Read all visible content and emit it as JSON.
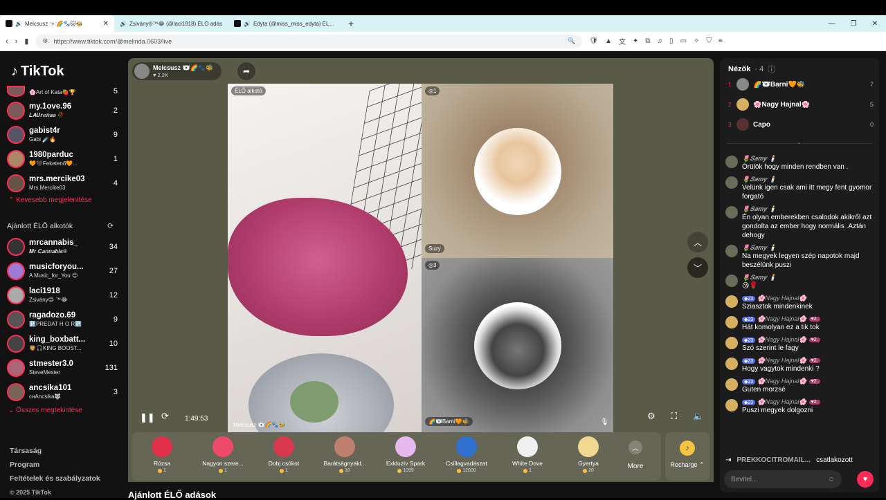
{
  "browser": {
    "tabs": [
      {
        "title": "Melcsusz 🐻‍❄️🌈🐾🐱🐝",
        "active": true
      },
      {
        "title": "Zsivány®™😂 (@laci1918) ÉLŐ adás",
        "active": false
      },
      {
        "title": "Edyta (@miss_miss_edyta) ÉLŐ ad",
        "active": false
      }
    ],
    "new_tab": "+",
    "url": "https://www.tiktok.com/@melinda.0603/live"
  },
  "sidebar": {
    "logo": "TikTok",
    "followed": [
      {
        "name": "",
        "sub": "🌸Art of Kata🍓🏆",
        "count": "5"
      },
      {
        "name": "my.1ove.96",
        "sub": "𝑳𝑨𝑼𝒓𝒆𝒏𝒂𝒂 🥀",
        "count": "2"
      },
      {
        "name": "gabist4r",
        "sub": "Gabi ☄️🔥",
        "count": "9"
      },
      {
        "name": "1980parduc",
        "sub": "🧡🖤Feketenő🧡...",
        "count": "1"
      },
      {
        "name": "mrs.mercike03",
        "sub": "Mrs.Mercike03",
        "count": "4"
      }
    ],
    "show_less": "Kevesebb megjelenítése",
    "suggested_title": "Ajánlott ÉLŐ alkotók",
    "suggested": [
      {
        "name": "mrcannabis_",
        "sub": "𝑴𝒓.𝑪𝒂𝒏𝒏𝒂𝒃𝒊𝒔®",
        "count": "34"
      },
      {
        "name": "musicforyou...",
        "sub": "A Music_for_You 😊",
        "count": "27"
      },
      {
        "name": "laci1918",
        "sub": "Zsivány😊 ™😂",
        "count": "12"
      },
      {
        "name": "ragadozo.69",
        "sub": "🅿️PREDAT H O R🅿️",
        "count": "9"
      },
      {
        "name": "king_boxbatt...",
        "sub": "🦁🎧KING BOOST...",
        "count": "10"
      },
      {
        "name": "stmester3.0",
        "sub": "SteveMester",
        "count": "131"
      },
      {
        "name": "ancsika101",
        "sub": "ᴄʜAncsika🐺",
        "count": "3"
      }
    ],
    "show_all": "Összes megtekintése",
    "footer_links": [
      "Társaság",
      "Program",
      "Feltételek és szabályzatok"
    ],
    "copyright": "© 2025 TikTok"
  },
  "stream": {
    "host_name": "Melcsusz 🐻‍❄️🌈🐾🐝",
    "host_likes": "♥ 2.2K",
    "live_tag": "ÉLŐ alkotó",
    "guest1_badge": "◎1",
    "guest1_name": "Suzy",
    "guest2_badge": "◎3",
    "guest2_name": "🌈🐻‍❄️Barni🧡🐝",
    "main_name": "Melcsusz 🐻‍❄️🌈🐾🐝",
    "timer": "1:49:53"
  },
  "gifts": [
    {
      "name": "Rózsa",
      "price": "1",
      "color": "#e0304a"
    },
    {
      "name": "Nagyon szere...",
      "price": "1",
      "color": "#f04a6a"
    },
    {
      "name": "Dobj csókot",
      "price": "1",
      "color": "#d83850"
    },
    {
      "name": "Barátságnyakl...",
      "price": "10",
      "color": "#c08070"
    },
    {
      "name": "Exkluzív Spark",
      "price": "1099",
      "color": "#e8b8f0"
    },
    {
      "name": "Csillagvadászat",
      "price": "12000",
      "color": "#3070d0"
    },
    {
      "name": "White Dove",
      "price": "1",
      "color": "#f0f0f0"
    },
    {
      "name": "Gyertya",
      "price": "20",
      "color": "#f0d890"
    }
  ],
  "more_label": "More",
  "recharge_label": "Recharge ⌃",
  "bottom_title": "Ajánlott ÉLŐ adások",
  "viewers": {
    "title": "Nézők",
    "count": "· 4",
    "list": [
      {
        "rank": "1",
        "name": "🌈🐻‍❄️Barni🧡🐝",
        "count": "7"
      },
      {
        "rank": "2",
        "name": "🌸Nagy Hajnal🌸",
        "count": "5"
      },
      {
        "rank": "3",
        "name": "Capo",
        "count": "0"
      }
    ]
  },
  "chat": [
    {
      "user": "🌷𝑺𝒂𝒎𝒚 🕯️",
      "text": "Örülök hogy minden rendben van ."
    },
    {
      "user": "🌷𝑺𝒂𝒎𝒚 🕯️",
      "text": "Velünk igen csak ami itt megy fent gyomor forgató"
    },
    {
      "user": "🌷𝑺𝒂𝒎𝒚 🕯️",
      "text": "Én olyan emberekben csalodok akikről azt gondolta az ember hogy normális .Aztán dehogy"
    },
    {
      "user": "🌷𝑺𝒂𝒎𝒚 🕯️",
      "text": "Na megyek legyen szép napotok majd beszélünk puszi"
    },
    {
      "user": "🌷𝑺𝒂𝒎𝒚 🕯️",
      "text": "😘🌹"
    },
    {
      "user": "🌸Nagy Hajnal🌸",
      "lvl": "23",
      "text": "Sziasztok mindenkinek"
    },
    {
      "user": "🌸Nagy Hajnal🌸",
      "lvl": "23",
      "fan": "2.",
      "text": "Hát komolyan ez a tik tok"
    },
    {
      "user": "🌸Nagy Hajnal🌸",
      "lvl": "23",
      "fan": "2.",
      "text": "Szó szerint le fagy"
    },
    {
      "user": "🌸Nagy Hajnal🌸",
      "lvl": "23",
      "fan": "2.",
      "text": "Hogy vagytok mindenki ?"
    },
    {
      "user": "🌸Nagy Hajnal🌸",
      "lvl": "23",
      "fan": "2.",
      "text": "Guten morzsé"
    },
    {
      "user": "🌸Nagy Hajnal🌸",
      "lvl": "23",
      "fan": "2.",
      "text": "Puszi megyek dolgozni"
    }
  ],
  "joined": {
    "who": "PREKKOCITROMAIL...",
    "action": "csatlakozott"
  },
  "chat_placeholder": "Bevitel..."
}
